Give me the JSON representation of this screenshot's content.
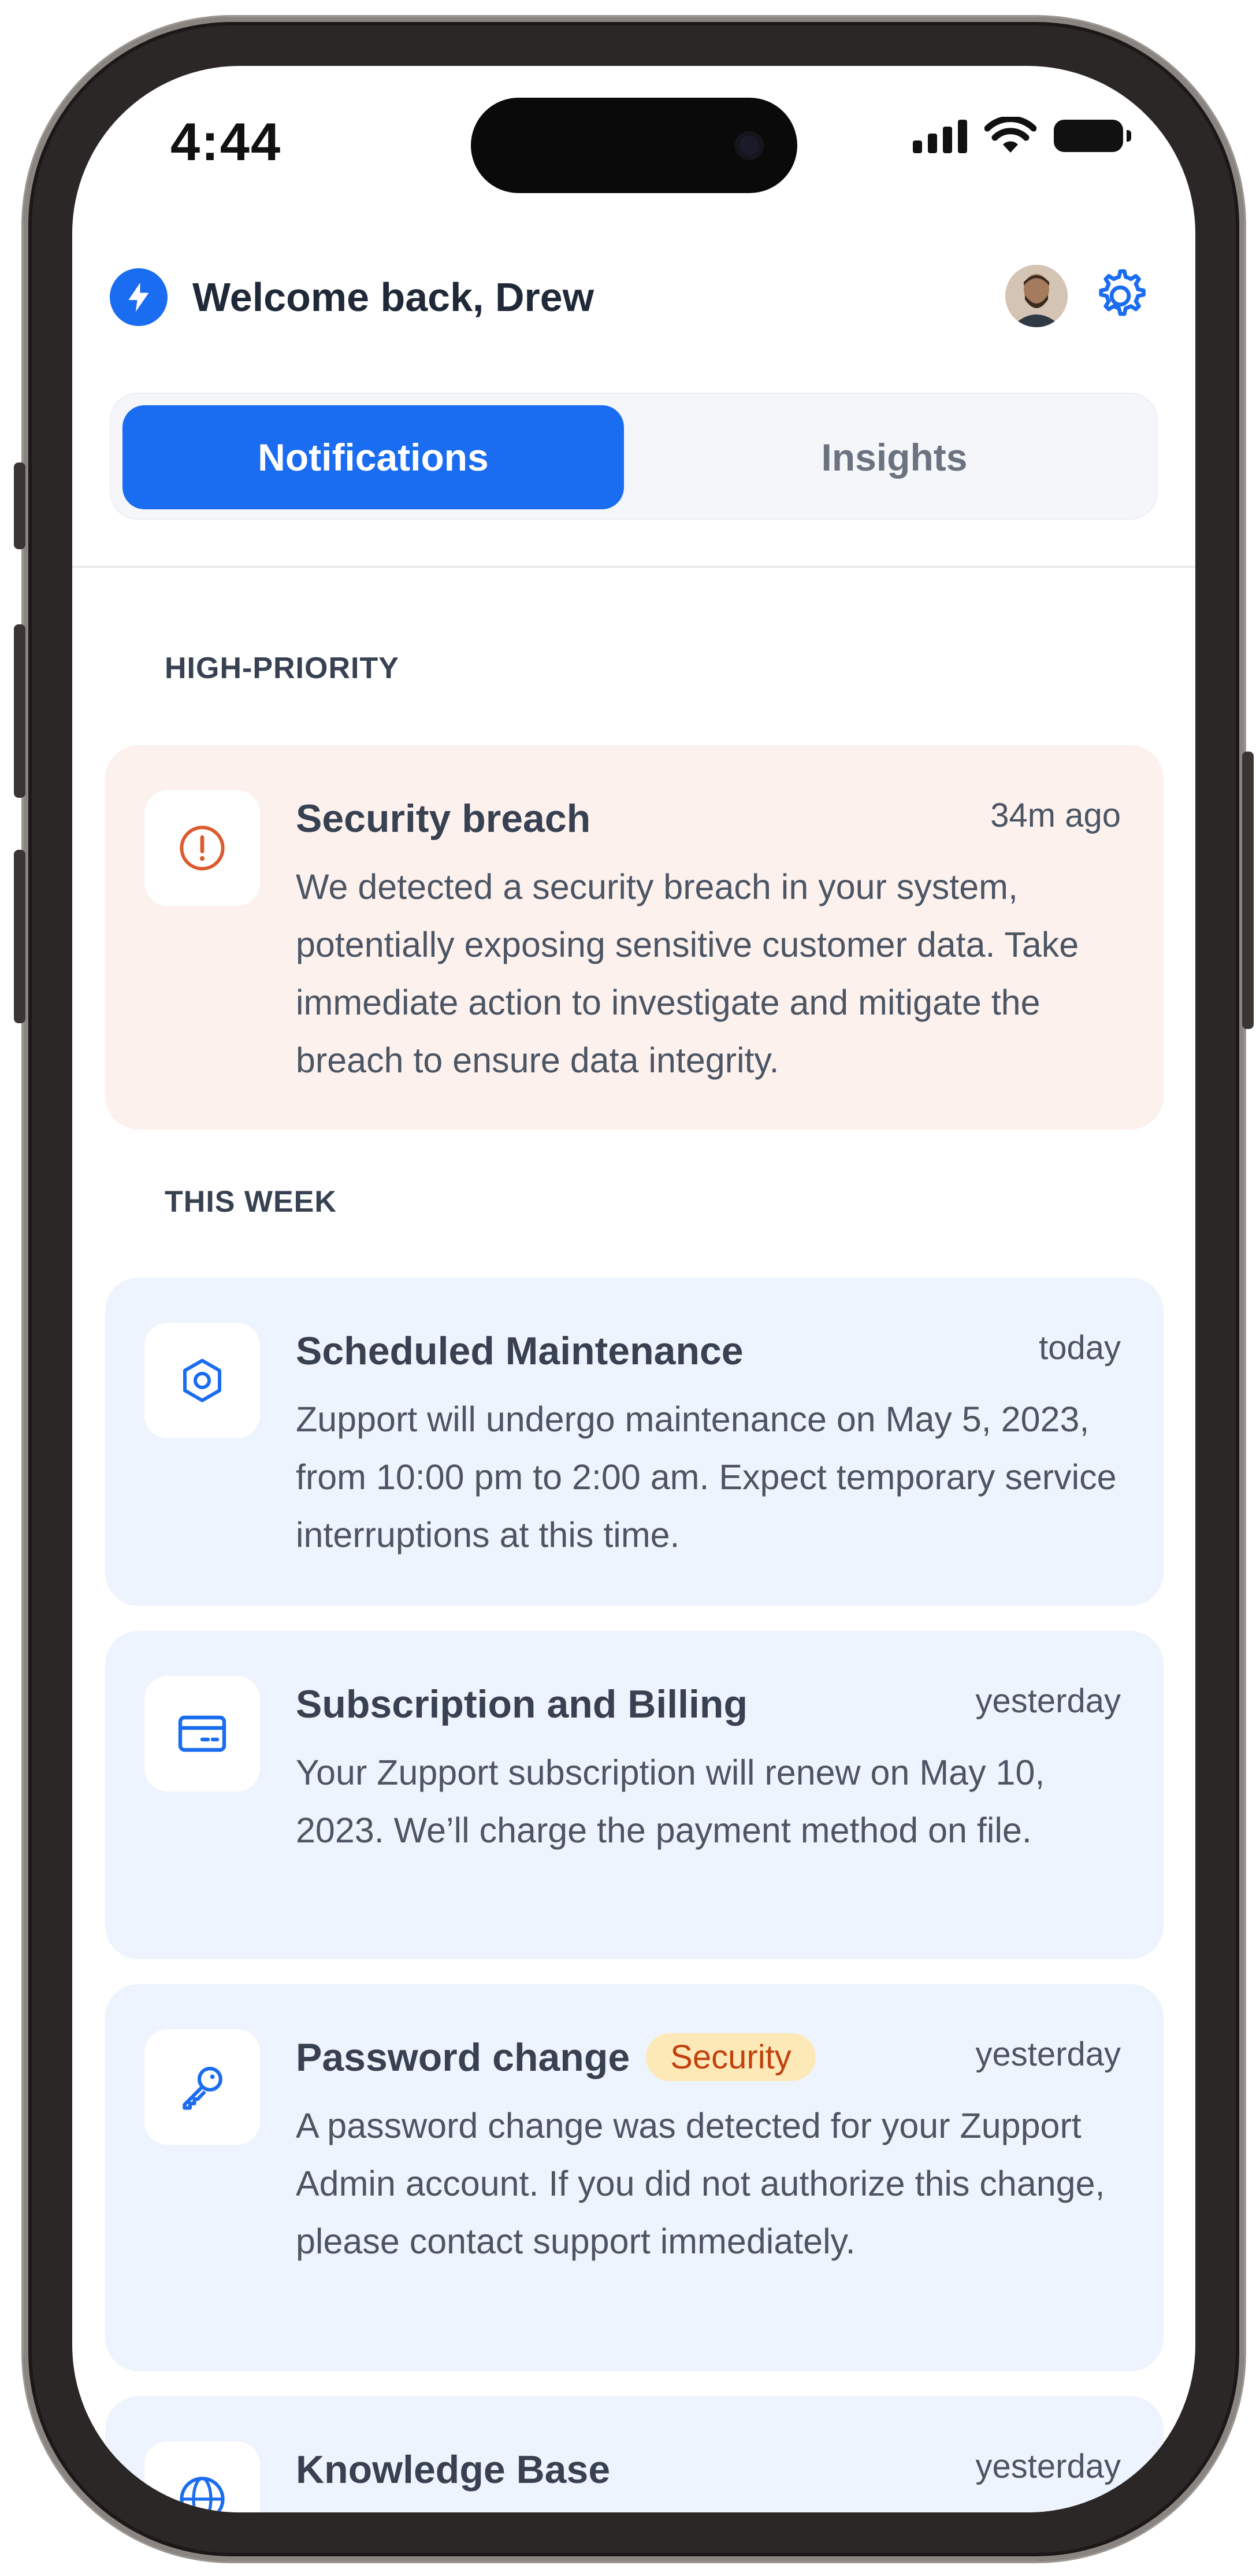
{
  "status_bar": {
    "time": "4:44"
  },
  "header": {
    "greeting": "Welcome back, Drew"
  },
  "tabs": [
    {
      "label": "Notifications",
      "active": true
    },
    {
      "label": "Insights",
      "active": false
    }
  ],
  "sections": {
    "high_priority": "HIGH-PRIORITY",
    "this_week": "THIS WEEK"
  },
  "notifications": [
    {
      "title": "Security breach",
      "time": "34m ago",
      "body": "We detected a security breach in your system, potentially exposing sensitive customer data. Take immediate action to investigate and mitigate the breach to ensure data integrity.",
      "icon": "alert-circle-icon",
      "accent": "#dc5a2e"
    },
    {
      "title": "Scheduled Maintenance",
      "time": "today",
      "body": "Zupport will undergo maintenance on May 5, 2023, from 10:00 pm to 2:00 am. Expect temporary service interruptions at this time.",
      "icon": "hexagon-nut-icon",
      "accent": "#1a6cf0"
    },
    {
      "title": "Subscription and Billing",
      "time": "yesterday",
      "body": "Your Zupport  subscription will renew on May 10, 2023. We’ll charge the payment method on file.",
      "icon": "credit-card-icon",
      "accent": "#1a6cf0"
    },
    {
      "title": "Password change",
      "badge": "Security",
      "time": "yesterday",
      "body": "A password change was detected for your Zupport Admin account. If you did not authorize this change, please contact support immediately.",
      "icon": "key-icon",
      "accent": "#1a6cf0"
    },
    {
      "title": "Knowledge Base",
      "time": "yesterday",
      "icon": "globe-icon",
      "accent": "#1a6cf0"
    }
  ],
  "colors": {
    "primary": "#1a6cf0",
    "alert_bg": "#fdf1ee",
    "info_bg": "#eef4fd",
    "badge_bg": "#fde9b8",
    "badge_text": "#c2410c"
  }
}
